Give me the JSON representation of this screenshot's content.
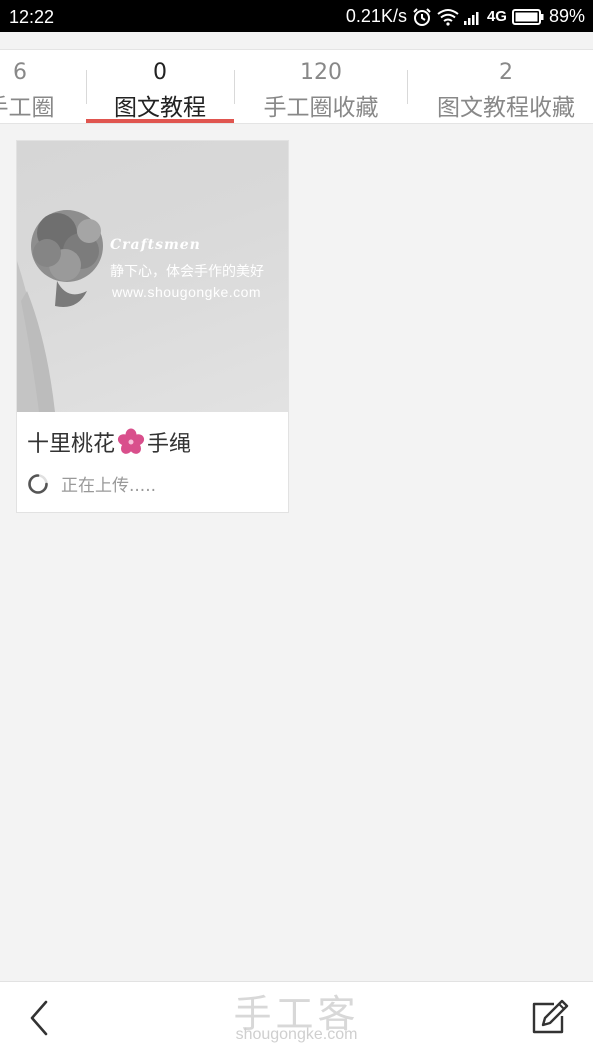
{
  "status_bar": {
    "time": "12:22",
    "network_speed": "0.21K/s",
    "network_type": "4G",
    "battery": "89%",
    "icons": [
      "alarm-icon",
      "wifi-icon",
      "signal-icon",
      "battery-icon"
    ]
  },
  "tabs": [
    {
      "count": "6",
      "label": "手工圈",
      "active": false
    },
    {
      "count": "0",
      "label": "图文教程",
      "active": true
    },
    {
      "count": "120",
      "label": "手工圈收藏",
      "active": false
    },
    {
      "count": "2",
      "label": "图文教程收藏",
      "active": false
    }
  ],
  "card": {
    "cover": {
      "brand": "Craftsmen",
      "slogan": "静下心，体会手作的美好",
      "site": "www.shougongke.com"
    },
    "title_part1": "十里桃花",
    "title_icon": "cherry-blossom-icon",
    "title_part2": "手绳",
    "status_text": "正在上传....."
  },
  "bottom_bar": {
    "back_icon": "chevron-left-icon",
    "edit_icon": "edit-icon",
    "watermark_cn": "手工客",
    "watermark_en": "shougongke.com"
  },
  "colors": {
    "accent": "#e0554f",
    "blossom": "#d94f8c"
  }
}
